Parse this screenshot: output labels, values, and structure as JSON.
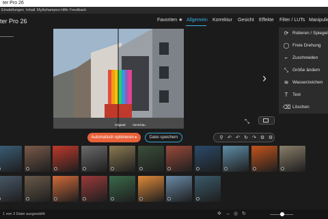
{
  "window": {
    "title": "ter Pro 26"
  },
  "menu": [
    "Einstellungen",
    "Inhalt",
    "MyAshampoo",
    "Hilfe",
    "Feedback"
  ],
  "app": {
    "name": "ter Pro 26"
  },
  "tabs": [
    "Favoriten ★",
    "Allgemein",
    "Korrektur",
    "Gesicht",
    "Effekte",
    "Filter / LUTs",
    "Manipulie"
  ],
  "active_tab": "Allgemein",
  "photo": {
    "left_label": "Original",
    "right_label": "Vorschau"
  },
  "tools_panel": [
    {
      "icon": "rotate-crop-icon",
      "glyph": "⟳",
      "label": "Rotieren / Spiegeln"
    },
    {
      "icon": "free-rotate-icon",
      "glyph": "◯",
      "label": "Freie Drehung"
    },
    {
      "icon": "crop-icon",
      "glyph": "⌐",
      "label": "Zuschneiden"
    },
    {
      "icon": "resize-icon",
      "glyph": "⤡",
      "label": "Größe ändern"
    },
    {
      "icon": "watermark-icon",
      "glyph": "≋",
      "label": "Wasserzeichen"
    },
    {
      "icon": "text-icon",
      "glyph": "T",
      "label": "Text"
    },
    {
      "icon": "delete-icon",
      "glyph": "⌫",
      "label": "Löschen"
    }
  ],
  "buttons": {
    "auto_optimize": "Automatisch optimieren",
    "auto_arrow": "▸",
    "save": "Datei speichern"
  },
  "toolbox": [
    "⚲",
    "↶",
    "↶",
    "↻",
    "↷",
    "⚙",
    "⚙"
  ],
  "thumbnails": [
    {
      "color": "#3b5f78"
    },
    {
      "color": "#7a5a4a"
    },
    {
      "color": "#c0392b"
    },
    {
      "color": "#6b6b6b"
    },
    {
      "color": "#8c7a52"
    },
    {
      "color": "#3a4f3a"
    },
    {
      "color": "#9a4a3a"
    },
    {
      "color": "#2a4a6a"
    },
    {
      "color": "#5e8ea8"
    },
    {
      "color": "#c4541c"
    },
    {
      "color": "#8a7e6a"
    },
    {
      "color": "#4a5a6a"
    },
    {
      "color": "#6a5a4a"
    },
    {
      "color": "#d06a3a"
    },
    {
      "color": "#9a3a3a"
    },
    {
      "color": "#3a6a4a"
    },
    {
      "color": "#e08a3a"
    },
    {
      "color": "#6a8aa8"
    },
    {
      "color": "#3a5a6a"
    }
  ],
  "status": {
    "text": "1 von 3 Datei ausgewählt",
    "icons": [
      "✣",
      "↔",
      "◎",
      "↻"
    ]
  }
}
